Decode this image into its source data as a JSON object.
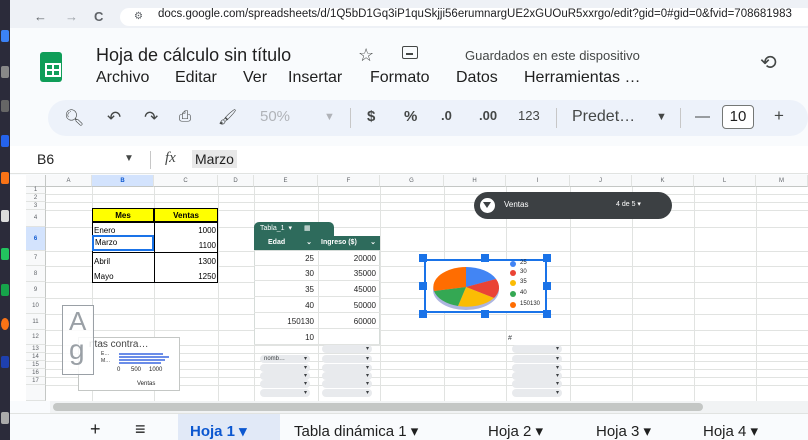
{
  "browser": {
    "back": "←",
    "forward": "→",
    "reload": "C",
    "url": "docs.google.com/spreadsheets/d/1Q5bD1Gq3iP1quSkjji56erumnargUE2xGUOuR5xxrgo/edit?gid=0#gid=0&fvid=708681983"
  },
  "doc": {
    "title": "Hoja de cálculo sin título",
    "star": "☆",
    "saved": "Guardados en este dispositivo",
    "menus": [
      "Archivo",
      "Editar",
      "Ver",
      "Insertar",
      "Formato",
      "Datos",
      "Herramientas …"
    ]
  },
  "toolbar": {
    "zoom": "50%",
    "currency": "$",
    "percent": "%",
    "dec_less": ".0",
    "dec_more": ".00",
    "number_fmt": "123",
    "font": "Predet…",
    "font_size": "10",
    "minus": "—",
    "plus": "+"
  },
  "formula_bar": {
    "cell_ref": "B6",
    "fx": "fx",
    "value": "Marzo"
  },
  "columns": [
    "A",
    "B",
    "C",
    "D",
    "E",
    "F",
    "G",
    "H",
    "I",
    "J",
    "K",
    "L",
    "M"
  ],
  "rows": [
    "1",
    "2",
    "3",
    "4",
    "5",
    "6",
    "7",
    "8",
    "9",
    "10",
    "11",
    "12",
    "13",
    "14",
    "15",
    "16",
    "17"
  ],
  "table1": {
    "headers": [
      "Mes",
      "Ventas"
    ],
    "rows": [
      [
        "Enero",
        "1000"
      ],
      [
        "Marzo",
        "1100"
      ],
      [
        "Abril",
        "1300"
      ],
      [
        "Mayo",
        "1250"
      ]
    ]
  },
  "pivot": {
    "tab_label": "Tabla_1",
    "headers": [
      "Edad",
      "Ingreso ($)"
    ],
    "rows": [
      [
        "25",
        "20000"
      ],
      [
        "30",
        "35000"
      ],
      [
        "35",
        "45000"
      ],
      [
        "40",
        "50000"
      ],
      [
        "150130",
        "60000"
      ],
      [
        "10",
        ""
      ]
    ]
  },
  "slicer": {
    "label": "Ventas",
    "count": "4 de 5 ▾"
  },
  "pie_legend": [
    "25",
    "30",
    "35",
    "40",
    "150130"
  ],
  "pie_chart": {
    "colors": [
      "#4285f4",
      "#ea4335",
      "#fbbc04",
      "#34a853",
      "#ff6d01"
    ]
  },
  "mini_chart": {
    "title": "ntas contra…",
    "labels": [
      "E…",
      "M…"
    ],
    "axis": [
      "0",
      "500",
      "1000"
    ],
    "xlabel": "Ventas"
  },
  "text_box": {
    "letters": [
      "A",
      "g"
    ]
  },
  "misc": {
    "hash": "#",
    "nomb": "nomb…"
  },
  "sheets": {
    "add": "+",
    "list": "≡",
    "tabs": [
      {
        "label": "Hoja 1 ▾",
        "active": true
      },
      {
        "label": "Tabla dinámica 1 ▾",
        "active": false
      },
      {
        "label": "Hoja 2 ▾",
        "active": false
      },
      {
        "label": "Hoja 3 ▾",
        "active": false
      },
      {
        "label": "Hoja 4 ▾",
        "active": false
      }
    ]
  },
  "colors": {
    "accent": "#0b57d0",
    "sheets_green": "#0f9d58",
    "pivot_green": "#2e6b5c",
    "yellow": "#ffff00"
  }
}
